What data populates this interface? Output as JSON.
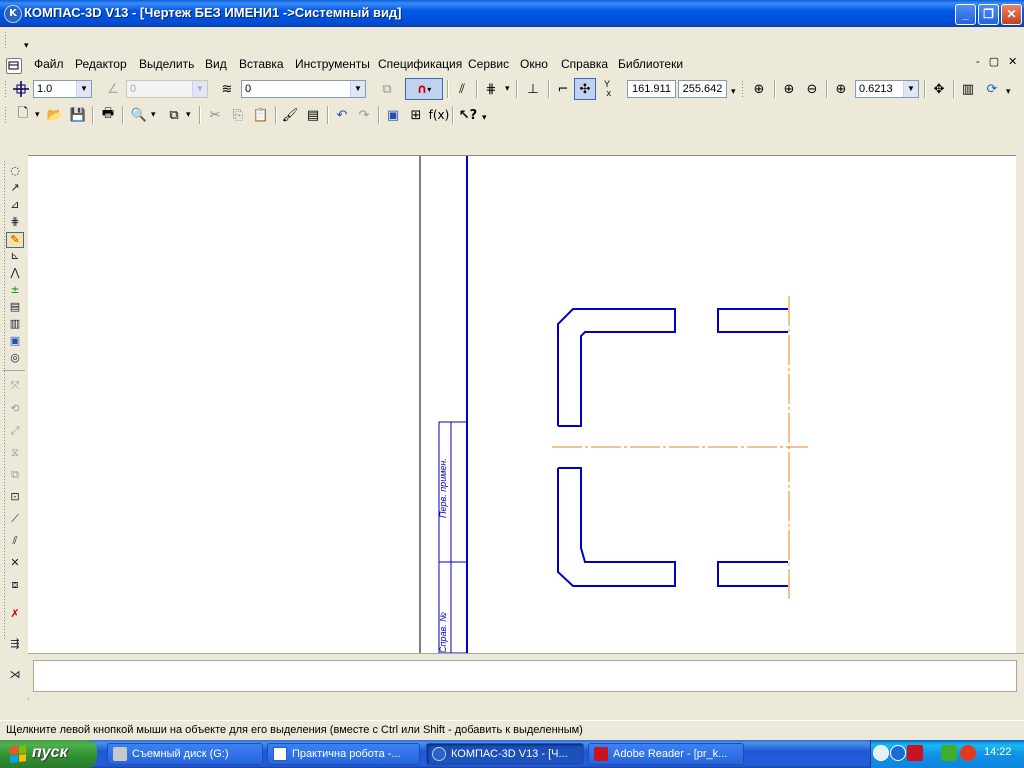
{
  "window": {
    "title": "КОМПАС-3D V13 - [Чертеж БЕЗ ИМЕНИ1 ->Системный вид]",
    "minimize": "_",
    "maximize": "❐",
    "close": "✕"
  },
  "menu": {
    "items": [
      {
        "label": "Файл"
      },
      {
        "label": "Редактор"
      },
      {
        "label": "Выделить"
      },
      {
        "label": "Вид"
      },
      {
        "label": "Вставка"
      },
      {
        "label": "Инструменты"
      },
      {
        "label": "Спецификация"
      },
      {
        "label": "Сервис"
      },
      {
        "label": "Окно"
      },
      {
        "label": "Справка"
      },
      {
        "label": "Библиотеки"
      }
    ],
    "mdi_controls": "-  ▢  ✕"
  },
  "toolbar_current": {
    "step_value": "1.0",
    "angle_value": "0",
    "layer_value": "0",
    "coord_x": "161.911",
    "coord_y": "255.642",
    "zoom_value": "0.6213"
  },
  "drawing_sheet": {
    "stamp_text_1": "Перв. примен.",
    "stamp_text_2": "Справ. №"
  },
  "status_bar": {
    "hint": "Щелкните левой кнопкой мыши на объекте для его выделения (вместе с Ctrl или Shift - добавить к выделенным)"
  },
  "taskbar": {
    "start_label": "пуск",
    "tasks": [
      {
        "label": "Съемный диск (G:)",
        "active": false
      },
      {
        "label": "Практична робота -...",
        "active": false
      },
      {
        "label": "КОМПАС-3D V13 - [Ч...",
        "active": true
      },
      {
        "label": "Adobe Reader - [pr_k...",
        "active": false
      }
    ],
    "clock": "14:22"
  },
  "colors": {
    "drawing_line": "#0000c8",
    "axis_line": "#e08a1e",
    "titlebar": "#0058e6"
  }
}
